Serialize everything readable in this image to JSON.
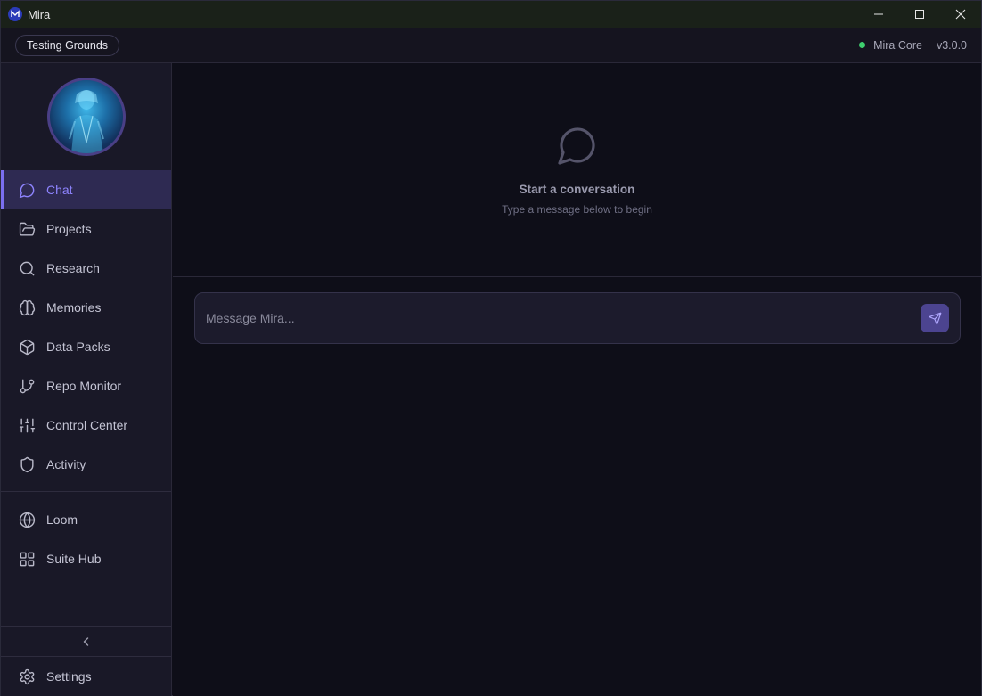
{
  "window": {
    "title": "Mira"
  },
  "topbar": {
    "workspace": "Testing Grounds",
    "status_label": "Mira Core",
    "status_color": "#3ecf6e",
    "version": "v3.0.0"
  },
  "sidebar": {
    "items": [
      {
        "label": "Chat",
        "icon": "chat-bubble-icon",
        "active": true
      },
      {
        "label": "Projects",
        "icon": "folder-icon"
      },
      {
        "label": "Research",
        "icon": "search-icon"
      },
      {
        "label": "Memories",
        "icon": "brain-icon"
      },
      {
        "label": "Data Packs",
        "icon": "package-icon"
      },
      {
        "label": "Repo Monitor",
        "icon": "git-branch-icon"
      },
      {
        "label": "Control Center",
        "icon": "sliders-icon"
      },
      {
        "label": "Activity",
        "icon": "shield-icon"
      }
    ],
    "secondary": [
      {
        "label": "Loom",
        "icon": "globe-icon"
      },
      {
        "label": "Suite Hub",
        "icon": "grid-icon"
      }
    ],
    "settings_label": "Settings"
  },
  "main": {
    "empty_title": "Start a conversation",
    "empty_subtitle": "Type a message below to begin",
    "composer_placeholder": "Message Mira..."
  },
  "colors": {
    "accent": "#7b6ff0",
    "background": "#0e0e18",
    "sidebar": "#191827"
  }
}
